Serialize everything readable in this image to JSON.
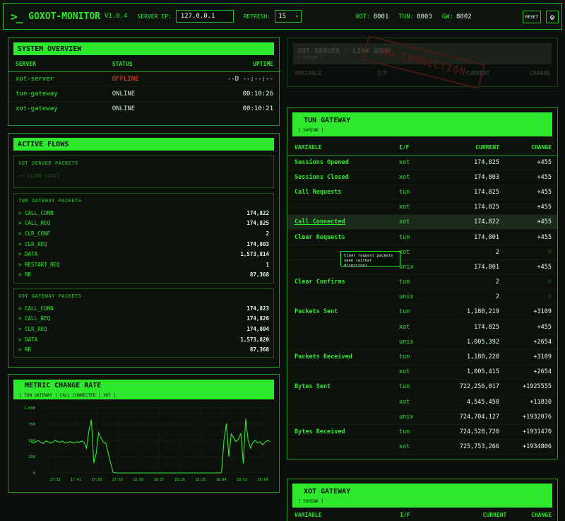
{
  "header": {
    "logo": ">_",
    "title": "GOXOT-MONITOR",
    "version": "V1.0.4",
    "server_ip_label": "SERVER IP:",
    "server_ip_value": "127.0.0.1",
    "refresh_label": "REFRESH:",
    "refresh_value": "1S",
    "ports": [
      {
        "label": "XOT:",
        "value": "8001"
      },
      {
        "label": "TUN:",
        "value": "8003"
      },
      {
        "label": "GW:",
        "value": "8002"
      }
    ],
    "reset_label": "RESET"
  },
  "system_overview": {
    "title": "SYSTEM OVERVIEW",
    "columns": [
      "SERVER",
      "STATUS",
      "UPTIME"
    ],
    "rows": [
      {
        "server": "xot-server",
        "status": "OFFLINE",
        "uptime": "--D --:--:--"
      },
      {
        "server": "tun-gateway",
        "status": "ONLINE",
        "uptime": "00:10:26"
      },
      {
        "server": "xot-gateway",
        "status": "ONLINE",
        "uptime": "00:10:21"
      }
    ]
  },
  "active_flows": {
    "title": "ACTIVE FLOWS",
    "xot_server": {
      "title": "XOT SERVER PACKETS",
      "lost": ">> [LINK LOST]"
    },
    "tun_gateway": {
      "title": "TUN GATEWAY PACKETS",
      "rows": [
        {
          "k": "> CALL_CONN",
          "v": "174,822"
        },
        {
          "k": "> CALL_REQ",
          "v": "174,825"
        },
        {
          "k": "> CLR_CONF",
          "v": "2"
        },
        {
          "k": "> CLR_REQ",
          "v": "174,803"
        },
        {
          "k": "> DATA",
          "v": "1,573,814"
        },
        {
          "k": "> RESTART_REQ",
          "v": "1"
        },
        {
          "k": "> RR",
          "v": "87,368"
        }
      ]
    },
    "xot_gateway": {
      "title": "XOT GATEWAY PACKETS",
      "rows": [
        {
          "k": "> CALL_CONN",
          "v": "174,823"
        },
        {
          "k": "> CALL_REQ",
          "v": "174,826"
        },
        {
          "k": "> CLR_REQ",
          "v": "174,804"
        },
        {
          "k": "> DATA",
          "v": "1,573,820"
        },
        {
          "k": "> RR",
          "v": "87,368"
        }
      ]
    }
  },
  "metric": {
    "title": "METRIC CHANGE RATE",
    "subtitle": "[ TUN GATEWAY | CALL CONNECTED | XOT ]"
  },
  "chart_data": {
    "type": "line",
    "title": "",
    "xlabel": "",
    "ylabel": "",
    "ylim": [
      0,
      1000
    ],
    "yticks": [
      "0",
      "250",
      "500",
      "750",
      "1,000"
    ],
    "xticks": [
      "17:32",
      "17:41",
      "17:50",
      "17:59",
      "18:08",
      "18:17",
      "18:26",
      "18:35",
      "18:44",
      "18:53",
      "19:04"
    ],
    "grid": true,
    "series": [
      {
        "values": [
          470,
          460,
          480,
          500,
          470,
          450,
          490,
          480,
          460,
          470,
          500,
          480,
          470,
          490,
          460,
          470,
          480,
          470,
          460,
          480,
          470,
          490,
          470,
          380,
          650,
          820,
          150,
          300,
          620,
          540,
          470,
          460,
          300,
          150,
          10,
          0,
          0,
          0,
          0,
          0,
          0,
          0,
          0,
          0,
          0,
          0,
          0,
          0,
          0,
          0,
          0,
          0,
          0,
          0,
          0,
          0,
          0,
          0,
          0,
          0,
          0,
          0,
          0,
          0,
          0,
          0,
          0,
          0,
          0,
          0,
          0,
          0,
          0,
          0,
          0,
          0,
          0,
          0,
          0,
          10,
          500,
          760,
          250,
          600,
          540,
          480,
          520,
          610,
          150,
          830,
          500,
          380,
          470,
          500,
          460,
          480,
          430,
          470,
          500,
          480
        ]
      }
    ]
  },
  "xot_server_panel": {
    "title": "XOT SERVER - LINK DOWN",
    "sub": "[ SHRINK ]",
    "columns": [
      "VARIABLE",
      "I/F",
      "CURRENT",
      "CHANGE"
    ],
    "stamp": "NO CONNECTION"
  },
  "tun_gateway_panel": {
    "title": "TUN GATEWAY",
    "sub": "[ SHRINK ]",
    "columns": [
      "VARIABLE",
      "I/F",
      "CURRENT",
      "CHANGE"
    ],
    "rows": [
      {
        "name": "Sessions Opened",
        "iface": "xot",
        "cur": "174,825",
        "chg": "+455"
      },
      {
        "name": "Sessions Closed",
        "iface": "xot",
        "cur": "174,803",
        "chg": "+455"
      },
      {
        "name": "Call Requests",
        "iface": "tun",
        "cur": "174,825",
        "chg": "+455"
      },
      {
        "name": "",
        "iface": "xot",
        "cur": "174,825",
        "chg": "+455"
      },
      {
        "name": "Call Connected",
        "iface": "xot",
        "cur": "174,822",
        "chg": "+455"
      },
      {
        "name": "Clear Requests",
        "iface": "tun",
        "cur": "174,801",
        "chg": "+455"
      },
      {
        "name": "",
        "iface": "xot",
        "cur": "2",
        "chg": "0"
      },
      {
        "name": "",
        "iface": "unix",
        "cur": "174,801",
        "chg": "+455"
      },
      {
        "name": "Clear Confirms",
        "iface": "tun",
        "cur": "2",
        "chg": "0"
      },
      {
        "name": "",
        "iface": "unix",
        "cur": "2",
        "chg": "0"
      },
      {
        "name": "Packets Sent",
        "iface": "tun",
        "cur": "1,180,219",
        "chg": "+3109"
      },
      {
        "name": "",
        "iface": "xot",
        "cur": "174,825",
        "chg": "+455"
      },
      {
        "name": "",
        "iface": "unix",
        "cur": "1,005,392",
        "chg": "+2654"
      },
      {
        "name": "Packets Received",
        "iface": "tun",
        "cur": "1,180,220",
        "chg": "+3109"
      },
      {
        "name": "",
        "iface": "xot",
        "cur": "1,005,415",
        "chg": "+2654"
      },
      {
        "name": "Bytes Sent",
        "iface": "tun",
        "cur": "722,256,017",
        "chg": "+1925555"
      },
      {
        "name": "",
        "iface": "xot",
        "cur": "4,545,450",
        "chg": "+11830"
      },
      {
        "name": "",
        "iface": "unix",
        "cur": "724,704,127",
        "chg": "+1932076"
      },
      {
        "name": "Bytes Received",
        "iface": "tun",
        "cur": "724,528,720",
        "chg": "+1931470"
      },
      {
        "name": "",
        "iface": "xot",
        "cur": "725,753,266",
        "chg": "+1934806"
      }
    ],
    "tooltip": "Clear request packets seen (either direction)"
  },
  "xot_gateway_panel": {
    "title": "XOT GATEWAY",
    "sub": "[ SHRINK ]",
    "columns": [
      "VARIABLE",
      "I/F",
      "CURRENT",
      "CHANGE"
    ]
  }
}
